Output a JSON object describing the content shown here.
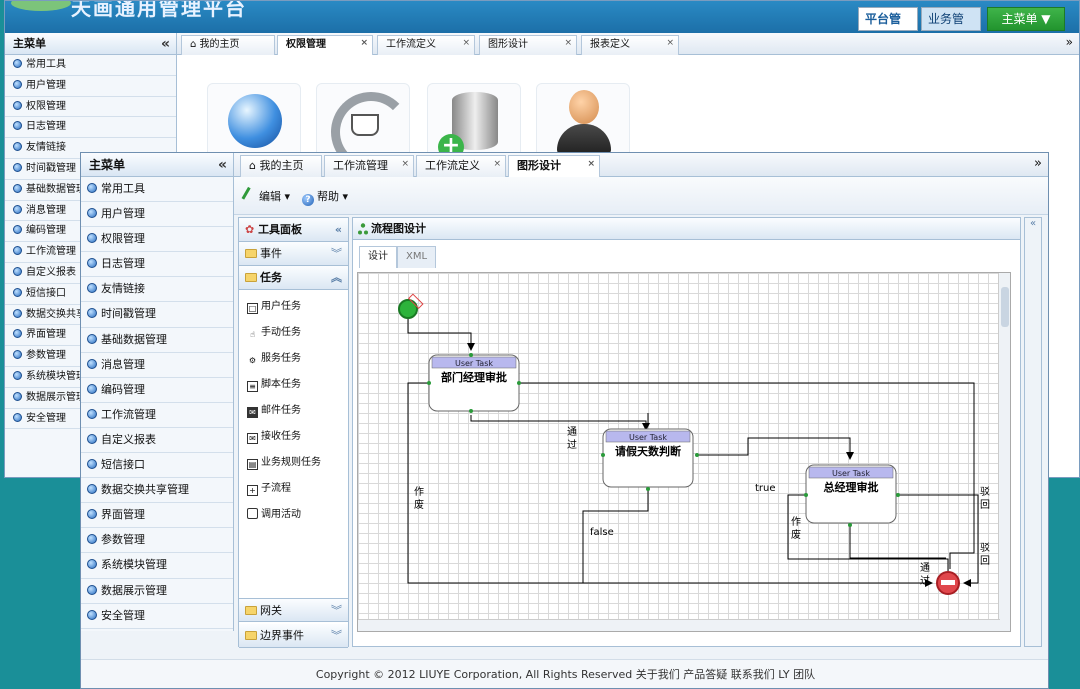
{
  "back": {
    "title": "天画通用管理平台",
    "buttons": {
      "platform": "平台管理",
      "business": "业务管理",
      "mainmenu": "主菜单 ▼"
    },
    "sidebar": {
      "header": "主菜单",
      "items": [
        "常用工具",
        "用户管理",
        "权限管理",
        "日志管理",
        "友情链接",
        "时间戳管理",
        "基础数据管理",
        "消息管理",
        "编码管理",
        "工作流管理",
        "自定义报表",
        "短信接口",
        "数据交换共享管理",
        "界面管理",
        "参数管理",
        "系统模块管理",
        "数据展示管理",
        "安全管理"
      ]
    },
    "tabs": [
      "我的主页",
      "权限管理",
      "工作流定义",
      "图形设计",
      "报表定义"
    ]
  },
  "front": {
    "sidebar": {
      "header": "主菜单",
      "items": [
        "常用工具",
        "用户管理",
        "权限管理",
        "日志管理",
        "友情链接",
        "时间戳管理",
        "基础数据管理",
        "消息管理",
        "编码管理",
        "工作流管理",
        "自定义报表",
        "短信接口",
        "数据交换共享管理",
        "界面管理",
        "参数管理",
        "系统模块管理",
        "数据展示管理",
        "安全管理"
      ]
    },
    "tabs": [
      "我的主页",
      "工作流管理",
      "工作流定义",
      "图形设计"
    ],
    "toolbar": {
      "edit": "编辑",
      "help": "帮助"
    },
    "toolbox": {
      "title": "工具面板",
      "events": "事件",
      "tasks": "任务",
      "task_items": [
        "用户任务",
        "手动任务",
        "服务任务",
        "脚本任务",
        "邮件任务",
        "接收任务",
        "业务规则任务",
        "子流程",
        "调用活动"
      ],
      "gateway": "网关",
      "boundary": "边界事件"
    },
    "flow": {
      "title": "流程图设计",
      "tabs": {
        "design": "设计",
        "xml": "XML"
      },
      "nodes": {
        "user_task_label": "User Task",
        "dept": "部门经理审批",
        "days": "请假天数判断",
        "gm": "总经理审批"
      },
      "edges": {
        "pass": "通过",
        "void": "作废",
        "true": "true",
        "false": "false",
        "reject": "驳回"
      }
    },
    "footer": "Copyright © 2012 LIUYE Corporation, All Rights Reserved 关于我们  产品答疑  联系我们  LY 团队"
  },
  "colors": {
    "accent": "#2a8ac4",
    "bg": "#1a8f98",
    "start": "#2db33b",
    "end": "#e0474c"
  }
}
